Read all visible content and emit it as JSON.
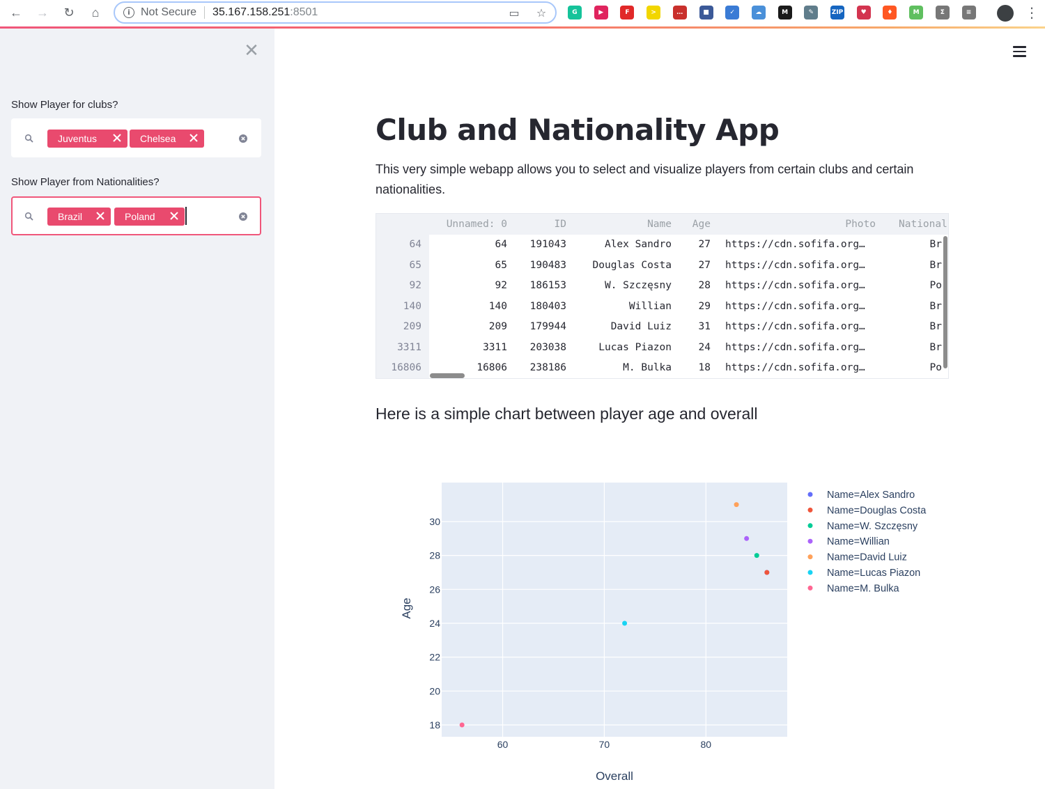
{
  "browser": {
    "not_secure_label": "Not Secure",
    "url_host": "35.167.158.251",
    "url_port": ":8501",
    "extensions": [
      "grammarly-icon",
      "youtube-icon",
      "flipboard-icon",
      "ext-arrow-icon",
      "ext-dots-icon",
      "ext-folder-icon",
      "ext-shield-icon",
      "ext-cloud-icon",
      "ext-m-icon",
      "ext-pen-icon",
      "ext-zip-icon",
      "pocket-icon",
      "ext-flame-icon",
      "ext-m2-icon",
      "ext-sigma-icon",
      "ext-db-icon"
    ]
  },
  "sidebar": {
    "clubs_label": "Show Player for clubs?",
    "clubs_selected": [
      "Juventus",
      "Chelsea"
    ],
    "nationalities_label": "Show Player from Nationalities?",
    "nationalities_selected": [
      "Brazil",
      "Poland"
    ]
  },
  "main": {
    "title": "Club and Nationality App",
    "description": "This very simple webapp allows you to select and visualize players from certain clubs and certain nationalities.",
    "chart_heading": "Here is a simple chart between player age and overall"
  },
  "table": {
    "columns": [
      "Unnamed: 0",
      "ID",
      "Name",
      "Age",
      "Photo",
      "National"
    ],
    "rows": [
      {
        "index": "64",
        "unnamed": "64",
        "id": "191043",
        "name": "Alex Sandro",
        "age": "27",
        "photo": "https://cdn.sofifa.org…",
        "nat": "Br"
      },
      {
        "index": "65",
        "unnamed": "65",
        "id": "190483",
        "name": "Douglas Costa",
        "age": "27",
        "photo": "https://cdn.sofifa.org…",
        "nat": "Br"
      },
      {
        "index": "92",
        "unnamed": "92",
        "id": "186153",
        "name": "W. Szczęsny",
        "age": "28",
        "photo": "https://cdn.sofifa.org…",
        "nat": "Po"
      },
      {
        "index": "140",
        "unnamed": "140",
        "id": "180403",
        "name": "Willian",
        "age": "29",
        "photo": "https://cdn.sofifa.org…",
        "nat": "Br"
      },
      {
        "index": "209",
        "unnamed": "209",
        "id": "179944",
        "name": "David Luiz",
        "age": "31",
        "photo": "https://cdn.sofifa.org…",
        "nat": "Br"
      },
      {
        "index": "3311",
        "unnamed": "3311",
        "id": "203038",
        "name": "Lucas Piazon",
        "age": "24",
        "photo": "https://cdn.sofifa.org…",
        "nat": "Br"
      },
      {
        "index": "16806",
        "unnamed": "16806",
        "id": "238186",
        "name": "M. Bulka",
        "age": "18",
        "photo": "https://cdn.sofifa.org…",
        "nat": "Po"
      }
    ]
  },
  "chart_data": {
    "type": "scatter",
    "title": "",
    "xlabel": "Overall",
    "ylabel": "Age",
    "xlim": [
      54,
      88
    ],
    "ylim": [
      17.3,
      32.3
    ],
    "xticks": [
      60,
      70,
      80
    ],
    "yticks": [
      18,
      20,
      22,
      24,
      26,
      28,
      30
    ],
    "grid": true,
    "legend_position": "right",
    "series": [
      {
        "name": "Name=Alex Sandro",
        "color": "#636efa",
        "x": [
          86
        ],
        "y": [
          27
        ]
      },
      {
        "name": "Name=Douglas Costa",
        "color": "#ef553b",
        "x": [
          86
        ],
        "y": [
          27
        ]
      },
      {
        "name": "Name=W. Szczęsny",
        "color": "#00cc96",
        "x": [
          85
        ],
        "y": [
          28
        ]
      },
      {
        "name": "Name=Willian",
        "color": "#ab63fa",
        "x": [
          84
        ],
        "y": [
          29
        ]
      },
      {
        "name": "Name=David Luiz",
        "color": "#ffa15a",
        "x": [
          83
        ],
        "y": [
          31
        ]
      },
      {
        "name": "Name=Lucas Piazon",
        "color": "#19d3f3",
        "x": [
          72
        ],
        "y": [
          24
        ]
      },
      {
        "name": "Name=M. Bulka",
        "color": "#ff6692",
        "x": [
          56
        ],
        "y": [
          18
        ]
      }
    ]
  }
}
